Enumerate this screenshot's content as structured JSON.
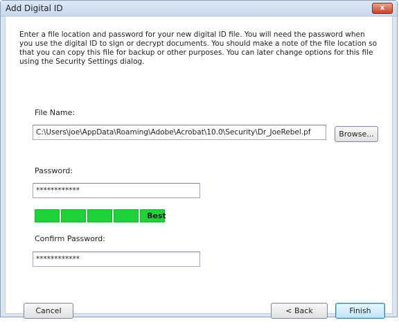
{
  "window": {
    "title": "Add Digital ID",
    "close_label": "x"
  },
  "intro_text": "Enter a file location and password for your new digital ID file. You will need the password when you use the digital ID to sign or decrypt documents. You should make a note of the file location so that you can copy this file for backup or other purposes. You can later change options for this file using the Security Settings dialog.",
  "file_name": {
    "label": "File Name:",
    "value": "C:\\Users\\joe\\AppData\\Roaming\\Adobe\\Acrobat\\10.0\\Security\\Dr_JoeRebel.pf",
    "browse_label": "Browse..."
  },
  "password": {
    "label": "Password:",
    "value": "************"
  },
  "strength": {
    "segments_filled": 5,
    "segments_total": 5,
    "label": "Best",
    "color": "#1fd23a"
  },
  "confirm_password": {
    "label": "Confirm Password:",
    "value": "************"
  },
  "buttons": {
    "cancel": "Cancel",
    "back": "< Back",
    "finish": "Finish"
  }
}
